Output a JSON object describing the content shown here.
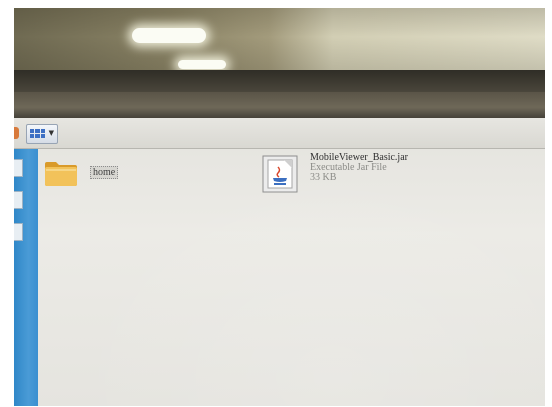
{
  "explorer": {
    "items": [
      {
        "label": "home",
        "icon": "folder-icon"
      },
      {
        "name": "MobileViewer_Basic.jar",
        "type": "Executable Jar File",
        "size": "33 KB",
        "icon": "java-jar-icon"
      }
    ]
  },
  "colors": {
    "sidebar": "#3b8fd0",
    "screen_background": "#e9e8e3",
    "folder": "#e9b94a"
  }
}
